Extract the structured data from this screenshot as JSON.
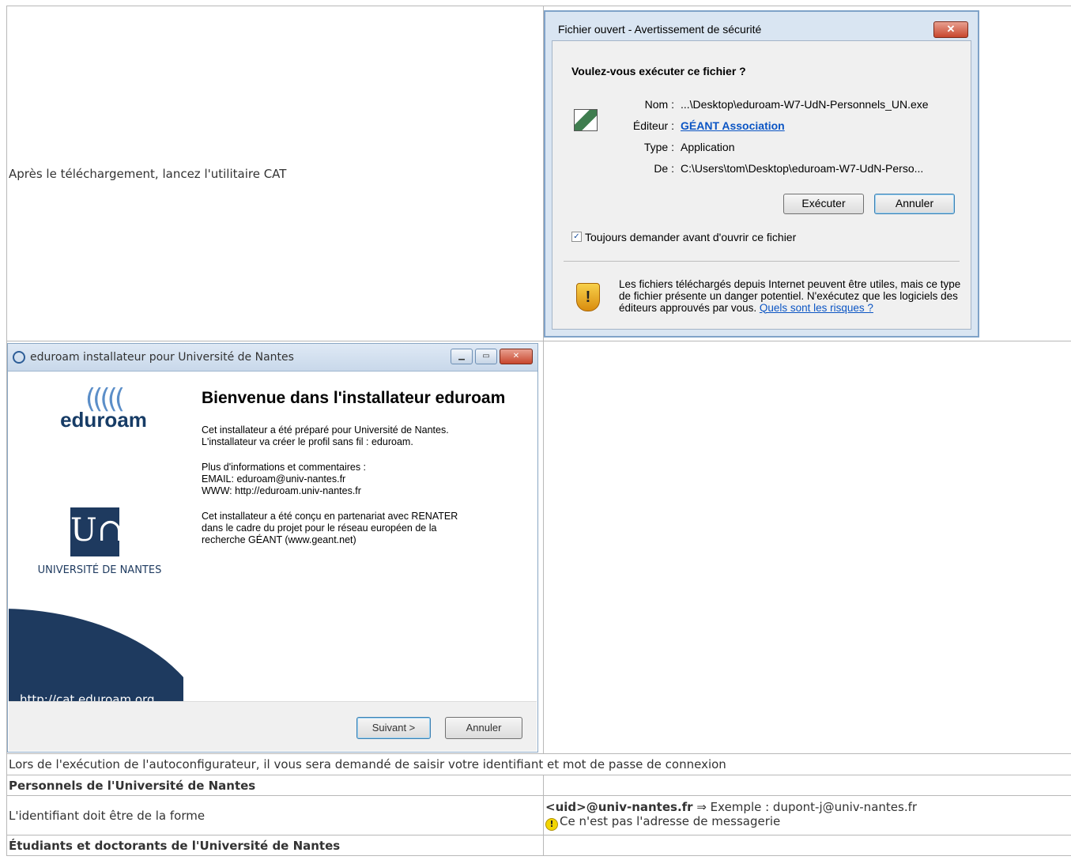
{
  "row1": {
    "text": "Après le téléchargement, lancez l'utilitaire CAT"
  },
  "security_dialog": {
    "title": "Fichier ouvert - Avertissement de sécurité",
    "close": "✕",
    "question": "Voulez-vous exécuter ce fichier ?",
    "fields": [
      {
        "label": "Nom :",
        "value": "...\\Desktop\\eduroam-W7-UdN-Personnels_UN.exe"
      },
      {
        "label": "Éditeur :",
        "value": "GÉANT Association"
      },
      {
        "label": "Type :",
        "value": "Application"
      },
      {
        "label": "De :",
        "value": "C:\\Users\\tom\\Desktop\\eduroam-W7-UdN-Perso..."
      }
    ],
    "run_button": "Exécuter",
    "cancel_button": "Annuler",
    "checkbox_label": "Toujours demander avant d'ouvrir ce fichier",
    "checkbox_checked": true,
    "warning_text": "Les fichiers téléchargés depuis Internet peuvent être utiles, mais ce type de fichier présente un danger potentiel. N'exécutez que les logiciels des éditeurs approuvés par vous.",
    "warning_link": "Quels sont les risques ?"
  },
  "installer": {
    "title": "eduroam installateur pour Université de Nantes",
    "eduroam_logo": "eduroam",
    "university_logo_text": "UNIVERSITÉ DE NANTES",
    "university_monogram": "U∩",
    "cat_url": "http://cat.eduroam.org",
    "welcome_title": "Bienvenue dans l'installateur eduroam",
    "para1": "Cet installateur a été préparé pour Université de Nantes.\nL'installateur va créer le profil sans fil : eduroam.",
    "para2": "Plus d'informations et commentaires :\nEMAIL: eduroam@univ-nantes.fr\nWWW: http://eduroam.univ-nantes.fr",
    "para3": "Cet installateur a été conçu en partenariat avec RENATER\ndans le cadre du projet pour le réseau européen de la\nrecherche GÉANT (www.geant.net)",
    "next_button": "Suivant >",
    "cancel_button": "Annuler"
  },
  "row3": {
    "text": "Lors de l'exécution de l'autoconfigurateur, il vous sera demandé de saisir votre identifiant et mot de passe de connexion"
  },
  "row4": {
    "heading": "Personnels de l'Université de Nantes"
  },
  "row5": {
    "label": "L'identifiant doit être de la forme",
    "format": "<uid>@univ-nantes.fr",
    "arrow_example": " ⇒ Exemple : dupont-j@univ-nantes.fr",
    "note_icon": "!",
    "note": "Ce n'est pas l'adresse de messagerie"
  },
  "row6": {
    "heading": "Étudiants et doctorants de l'Université de Nantes"
  }
}
